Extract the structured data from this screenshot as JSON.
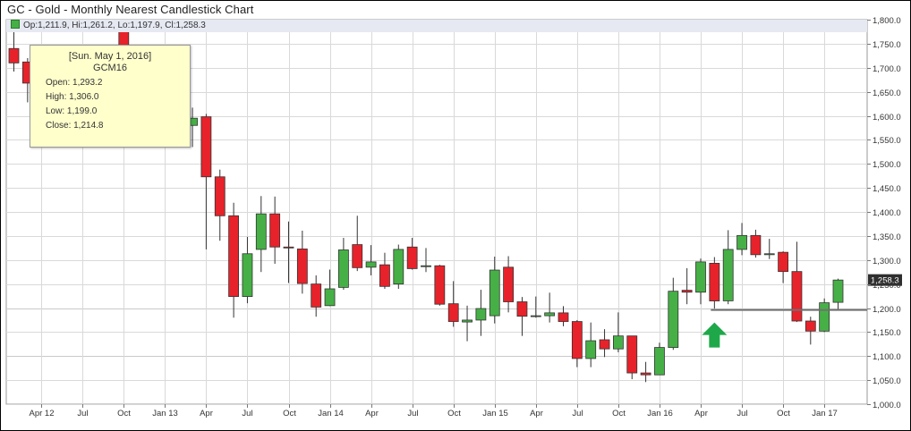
{
  "chart_title": "GC - Gold - Monthly Nearest Candlestick Chart",
  "ohlc_readout": "Op:1,211.9, Hi:1,261.2, Lo:1,197.9, Cl:1,258.3",
  "last_price_label": "1,258.3",
  "tooltip": {
    "date": "[Sun. May 1, 2016]",
    "symbol": "GCM16",
    "open": "Open: 1,293.2",
    "high": "High: 1,306.0",
    "low": "Low: 1,199.0",
    "close": "Close: 1,214.8"
  },
  "colors": {
    "up": "#46b046",
    "down": "#e8222a",
    "arrow": "#1fa84a",
    "support_line": "#707070",
    "grid": "#d9d9d9"
  },
  "annotations": {
    "support_level": 1196,
    "arrow": "up",
    "arrow_month": "2016-05"
  },
  "chart_data": {
    "type": "candlestick",
    "title": "GC - Gold - Monthly Nearest Candlestick Chart",
    "ylim": [
      1000,
      1800
    ],
    "y_ticks": [
      "1,000.0",
      "1,050.0",
      "1,100.0",
      "1,150.0",
      "1,200.0",
      "1,250.0",
      "1,300.0",
      "1,350.0",
      "1,400.0",
      "1,450.0",
      "1,500.0",
      "1,550.0",
      "1,600.0",
      "1,650.0",
      "1,700.0",
      "1,750.0",
      "1,800.0"
    ],
    "x_ticks": [
      {
        "label": "Apr 12",
        "month": "2012-04"
      },
      {
        "label": "Jul",
        "month": "2012-07"
      },
      {
        "label": "Oct",
        "month": "2012-10"
      },
      {
        "label": "Jan 13",
        "month": "2013-01"
      },
      {
        "label": "Apr",
        "month": "2013-04"
      },
      {
        "label": "Jul",
        "month": "2013-07"
      },
      {
        "label": "Oct",
        "month": "2013-10"
      },
      {
        "label": "Jan 14",
        "month": "2014-01"
      },
      {
        "label": "Apr",
        "month": "2014-04"
      },
      {
        "label": "Jul",
        "month": "2014-07"
      },
      {
        "label": "Oct",
        "month": "2014-10"
      },
      {
        "label": "Jan 15",
        "month": "2015-01"
      },
      {
        "label": "Apr",
        "month": "2015-04"
      },
      {
        "label": "Jul",
        "month": "2015-07"
      },
      {
        "label": "Oct",
        "month": "2015-10"
      },
      {
        "label": "Jan 16",
        "month": "2016-01"
      },
      {
        "label": "Apr",
        "month": "2016-04"
      },
      {
        "label": "Jul",
        "month": "2016-07"
      },
      {
        "label": "Oct",
        "month": "2016-10"
      },
      {
        "label": "Jan 17",
        "month": "2017-01"
      }
    ],
    "grid": true,
    "series": [
      {
        "candles": [
          {
            "month": "2012-02",
            "open": 1740,
            "high": 1792,
            "low": 1692,
            "close": 1710
          },
          {
            "month": "2012-03",
            "open": 1712,
            "high": 1720,
            "low": 1628,
            "close": 1668
          },
          {
            "month": "2012-10",
            "open": 1776,
            "high": 1798,
            "low": 1700,
            "close": 1720
          },
          {
            "month": "2013-02",
            "open": 1600,
            "high": 1625,
            "low": 1558,
            "close": 1582
          },
          {
            "month": "2013-03",
            "open": 1580,
            "high": 1617,
            "low": 1535,
            "close": 1595
          },
          {
            "month": "2013-04",
            "open": 1598,
            "high": 1604,
            "low": 1322,
            "close": 1473
          },
          {
            "month": "2013-05",
            "open": 1473,
            "high": 1488,
            "low": 1340,
            "close": 1392
          },
          {
            "month": "2013-06",
            "open": 1392,
            "high": 1419,
            "low": 1180,
            "close": 1224
          },
          {
            "month": "2013-07",
            "open": 1224,
            "high": 1348,
            "low": 1210,
            "close": 1313
          },
          {
            "month": "2013-08",
            "open": 1322,
            "high": 1433,
            "low": 1275,
            "close": 1396
          },
          {
            "month": "2013-09",
            "open": 1396,
            "high": 1432,
            "low": 1292,
            "close": 1327
          },
          {
            "month": "2013-10",
            "open": 1327,
            "high": 1380,
            "low": 1252,
            "close": 1325
          },
          {
            "month": "2013-11",
            "open": 1323,
            "high": 1361,
            "low": 1230,
            "close": 1251
          },
          {
            "month": "2013-12",
            "open": 1250,
            "high": 1268,
            "low": 1182,
            "close": 1202
          },
          {
            "month": "2014-01",
            "open": 1205,
            "high": 1280,
            "low": 1204,
            "close": 1240
          },
          {
            "month": "2014-02",
            "open": 1243,
            "high": 1346,
            "low": 1238,
            "close": 1321
          },
          {
            "month": "2014-03",
            "open": 1332,
            "high": 1392,
            "low": 1277,
            "close": 1284
          },
          {
            "month": "2014-04",
            "open": 1285,
            "high": 1331,
            "low": 1268,
            "close": 1296
          },
          {
            "month": "2014-05",
            "open": 1290,
            "high": 1315,
            "low": 1240,
            "close": 1245
          },
          {
            "month": "2014-06",
            "open": 1250,
            "high": 1332,
            "low": 1240,
            "close": 1322
          },
          {
            "month": "2014-07",
            "open": 1327,
            "high": 1346,
            "low": 1280,
            "close": 1282
          },
          {
            "month": "2014-08",
            "open": 1287,
            "high": 1325,
            "low": 1275,
            "close": 1288
          },
          {
            "month": "2014-09",
            "open": 1288,
            "high": 1290,
            "low": 1205,
            "close": 1208
          },
          {
            "month": "2014-10",
            "open": 1209,
            "high": 1256,
            "low": 1161,
            "close": 1172
          },
          {
            "month": "2014-11",
            "open": 1171,
            "high": 1205,
            "low": 1131,
            "close": 1175
          },
          {
            "month": "2014-12",
            "open": 1175,
            "high": 1238,
            "low": 1142,
            "close": 1199
          },
          {
            "month": "2015-01",
            "open": 1184,
            "high": 1307,
            "low": 1168,
            "close": 1279
          },
          {
            "month": "2015-02",
            "open": 1285,
            "high": 1308,
            "low": 1191,
            "close": 1213
          },
          {
            "month": "2015-03",
            "open": 1213,
            "high": 1223,
            "low": 1142,
            "close": 1183
          },
          {
            "month": "2015-04",
            "open": 1183,
            "high": 1224,
            "low": 1180,
            "close": 1184
          },
          {
            "month": "2015-05",
            "open": 1184,
            "high": 1232,
            "low": 1170,
            "close": 1190
          },
          {
            "month": "2015-06",
            "open": 1190,
            "high": 1204,
            "low": 1162,
            "close": 1172
          },
          {
            "month": "2015-07",
            "open": 1172,
            "high": 1175,
            "low": 1077,
            "close": 1095
          },
          {
            "month": "2015-08",
            "open": 1095,
            "high": 1170,
            "low": 1077,
            "close": 1132
          },
          {
            "month": "2015-09",
            "open": 1134,
            "high": 1156,
            "low": 1098,
            "close": 1115
          },
          {
            "month": "2015-10",
            "open": 1115,
            "high": 1191,
            "low": 1108,
            "close": 1142
          },
          {
            "month": "2015-11",
            "open": 1142,
            "high": 1142,
            "low": 1052,
            "close": 1065
          },
          {
            "month": "2015-12",
            "open": 1065,
            "high": 1088,
            "low": 1046,
            "close": 1061
          },
          {
            "month": "2016-01",
            "open": 1061,
            "high": 1128,
            "low": 1061,
            "close": 1118
          },
          {
            "month": "2016-02",
            "open": 1118,
            "high": 1263,
            "low": 1113,
            "close": 1235
          },
          {
            "month": "2016-03",
            "open": 1237,
            "high": 1283,
            "low": 1208,
            "close": 1233
          },
          {
            "month": "2016-04",
            "open": 1233,
            "high": 1303,
            "low": 1208,
            "close": 1296
          },
          {
            "month": "2016-05",
            "open": 1293.2,
            "high": 1306,
            "low": 1199,
            "close": 1214.8
          },
          {
            "month": "2016-06",
            "open": 1215,
            "high": 1362,
            "low": 1208,
            "close": 1322
          },
          {
            "month": "2016-07",
            "open": 1322,
            "high": 1377,
            "low": 1310,
            "close": 1351
          },
          {
            "month": "2016-08",
            "open": 1351,
            "high": 1363,
            "low": 1305,
            "close": 1311
          },
          {
            "month": "2016-09",
            "open": 1311,
            "high": 1344,
            "low": 1302,
            "close": 1313
          },
          {
            "month": "2016-10",
            "open": 1316,
            "high": 1318,
            "low": 1252,
            "close": 1276
          },
          {
            "month": "2016-11",
            "open": 1276,
            "high": 1338,
            "low": 1171,
            "close": 1173
          },
          {
            "month": "2016-12",
            "open": 1173,
            "high": 1182,
            "low": 1124,
            "close": 1152
          },
          {
            "month": "2017-01",
            "open": 1152,
            "high": 1220,
            "low": 1150,
            "close": 1211
          },
          {
            "month": "2017-02",
            "open": 1211.9,
            "high": 1261.2,
            "low": 1197.9,
            "close": 1258.3
          }
        ]
      }
    ]
  }
}
